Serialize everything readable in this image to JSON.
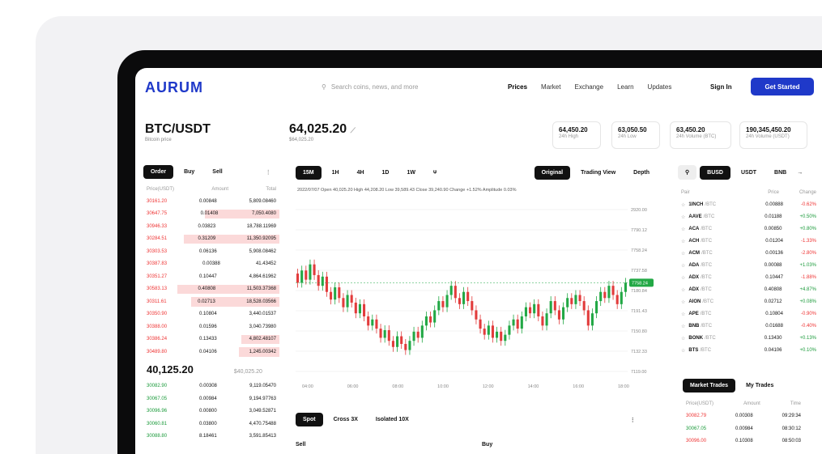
{
  "header": {
    "logo": "AURUM",
    "search_placeholder": "Search coins, news, and more",
    "nav": [
      "Prices",
      "Market",
      "Exchange",
      "Learn",
      "Updates"
    ],
    "signin": "Sign In",
    "get_started": "Get Started"
  },
  "pair": {
    "name": "BTC/USDT",
    "sub": "Bitcoin price"
  },
  "price": {
    "value": "64,025.20",
    "sub": "$64,025.20"
  },
  "stats": [
    {
      "value": "64,450.20",
      "label": "24h High"
    },
    {
      "value": "63,050.50",
      "label": "24h Low"
    },
    {
      "value": "63,450.20",
      "label": "24h Volume (BTC)"
    },
    {
      "value": "190,345,450.20",
      "label": "24h Volume (USDT)"
    }
  ],
  "orderbook": {
    "tabs": [
      "Order",
      "Buy",
      "Sell"
    ],
    "headers": [
      "Price(USDT)",
      "Amount",
      "Total"
    ],
    "asks": [
      [
        "30161.20",
        "0.00848",
        "5,809.08460",
        0.0
      ],
      [
        "30647.75",
        "0.01408",
        "7,050.4080",
        0.55
      ],
      [
        "30946.33",
        "0.03823",
        "18,788.11969",
        0.0
      ],
      [
        "30284.51",
        "0.31209",
        "11,350.92095",
        0.7
      ],
      [
        "30303.53",
        "0.06136",
        "5,908.08462",
        0.0
      ],
      [
        "30387.83",
        "0.00388",
        "41.43452",
        0.0
      ],
      [
        "30351.27",
        "0.10447",
        "4,864.61962",
        0.0
      ],
      [
        "30583.13",
        "0.40808",
        "11,503.37368",
        0.75
      ],
      [
        "30311.61",
        "0.02713",
        "18,528.03566",
        0.65
      ],
      [
        "30350.90",
        "0.10804",
        "3,440.01537",
        0.0
      ],
      [
        "30388.00",
        "0.01596",
        "3,040.73980",
        0.0
      ],
      [
        "30386.24",
        "0.13433",
        "4,802.48107",
        0.28
      ],
      [
        "30489.80",
        "0.04106",
        "1,245.00342",
        0.3
      ]
    ],
    "mid_price": "40,125.20",
    "mid_sub": "$40,025.20",
    "bids": [
      [
        "30082.90",
        "0.00308",
        "9,119.05470",
        0.0
      ],
      [
        "30067.05",
        "0.00984",
        "9,194.97763",
        0.0
      ],
      [
        "30096.96",
        "0.00800",
        "3,049.52871",
        0.0
      ],
      [
        "30060.81",
        "0.03800",
        "4,470.75488",
        0.0
      ],
      [
        "30088.80",
        "8.18461",
        "3,591.85413",
        0.0
      ]
    ]
  },
  "chart": {
    "intervals": [
      "15M",
      "1H",
      "4H",
      "1D",
      "1W"
    ],
    "views": [
      "Original",
      "Trading View",
      "Depth"
    ],
    "ohlc": "2022/07/07  Open 40,025.20  High 44,208.20  Low 39,589.43  Close 39,240.90  Change +1.52%  Amplitude 0.03%",
    "price_ticks": [
      "2920.00",
      "7790.12",
      "7758.24",
      "7737.58",
      "7180.84",
      "7191.43",
      "7150.80",
      "7132.33",
      "7119.00"
    ],
    "current_tag": "7758.24",
    "time_ticks": [
      "04:00",
      "06:00",
      "08:00",
      "10:00",
      "12:00",
      "14:00",
      "16:00",
      "18:00"
    ]
  },
  "chart_data": {
    "type": "candlestick",
    "candles": [
      [
        0.64,
        0.58
      ],
      [
        0.58,
        0.66
      ],
      [
        0.66,
        0.6
      ],
      [
        0.6,
        0.7
      ],
      [
        0.7,
        0.63
      ],
      [
        0.63,
        0.56
      ],
      [
        0.56,
        0.62
      ],
      [
        0.62,
        0.52
      ],
      [
        0.52,
        0.47
      ],
      [
        0.47,
        0.55
      ],
      [
        0.55,
        0.48
      ],
      [
        0.48,
        0.42
      ],
      [
        0.42,
        0.5
      ],
      [
        0.5,
        0.45
      ],
      [
        0.45,
        0.38
      ],
      [
        0.38,
        0.44
      ],
      [
        0.44,
        0.36
      ],
      [
        0.36,
        0.3
      ],
      [
        0.3,
        0.34
      ],
      [
        0.34,
        0.28
      ],
      [
        0.28,
        0.22
      ],
      [
        0.22,
        0.27
      ],
      [
        0.27,
        0.2
      ],
      [
        0.2,
        0.16
      ],
      [
        0.16,
        0.23
      ],
      [
        0.23,
        0.18
      ],
      [
        0.18,
        0.14
      ],
      [
        0.14,
        0.2
      ],
      [
        0.2,
        0.26
      ],
      [
        0.26,
        0.22
      ],
      [
        0.22,
        0.3
      ],
      [
        0.3,
        0.36
      ],
      [
        0.36,
        0.32
      ],
      [
        0.32,
        0.4
      ],
      [
        0.4,
        0.46
      ],
      [
        0.46,
        0.42
      ],
      [
        0.42,
        0.5
      ],
      [
        0.5,
        0.56
      ],
      [
        0.56,
        0.48
      ],
      [
        0.48,
        0.44
      ],
      [
        0.44,
        0.52
      ],
      [
        0.52,
        0.46
      ],
      [
        0.46,
        0.4
      ],
      [
        0.4,
        0.34
      ],
      [
        0.34,
        0.28
      ],
      [
        0.28,
        0.24
      ],
      [
        0.24,
        0.3
      ],
      [
        0.3,
        0.22
      ],
      [
        0.22,
        0.26
      ],
      [
        0.26,
        0.2
      ],
      [
        0.2,
        0.24
      ],
      [
        0.24,
        0.3
      ],
      [
        0.3,
        0.34
      ],
      [
        0.34,
        0.28
      ],
      [
        0.28,
        0.36
      ],
      [
        0.36,
        0.42
      ],
      [
        0.42,
        0.38
      ],
      [
        0.38,
        0.44
      ],
      [
        0.44,
        0.36
      ],
      [
        0.36,
        0.3
      ],
      [
        0.3,
        0.38
      ],
      [
        0.38,
        0.46
      ],
      [
        0.46,
        0.4
      ],
      [
        0.4,
        0.34
      ],
      [
        0.34,
        0.42
      ],
      [
        0.42,
        0.48
      ],
      [
        0.48,
        0.44
      ],
      [
        0.44,
        0.5
      ],
      [
        0.5,
        0.46
      ],
      [
        0.46,
        0.4
      ],
      [
        0.4,
        0.3
      ],
      [
        0.3,
        0.38
      ],
      [
        0.38,
        0.46
      ],
      [
        0.46,
        0.52
      ],
      [
        0.52,
        0.48
      ],
      [
        0.48,
        0.56
      ],
      [
        0.56,
        0.5
      ],
      [
        0.5,
        0.44
      ],
      [
        0.44,
        0.52
      ],
      [
        0.52,
        0.58
      ]
    ]
  },
  "orders": {
    "tabs": [
      "Spot",
      "Cross 3X",
      "Isolated 10X"
    ],
    "sell": "Sell",
    "buy": "Buy"
  },
  "markets": {
    "tabs": [
      "BUSD",
      "USDT",
      "BNB"
    ],
    "headers": [
      "Pair",
      "Price",
      "Change"
    ],
    "rows": [
      [
        "1INCH",
        "/BTC",
        "0.00888",
        "-0.62%",
        "red"
      ],
      [
        "AAVE",
        "/BTC",
        "0.01188",
        "+0.50%",
        "grn"
      ],
      [
        "ACA",
        "/BTC",
        "0.00850",
        "+0.80%",
        "grn"
      ],
      [
        "ACH",
        "/BTC",
        "0.01204",
        "-1.33%",
        "red"
      ],
      [
        "ACM",
        "/BTC",
        "0.00136",
        "-2.80%",
        "red"
      ],
      [
        "ADA",
        "/BTC",
        "0.00088",
        "+1.03%",
        "grn"
      ],
      [
        "ADX",
        "/BTC",
        "0.10447",
        "-1.88%",
        "red"
      ],
      [
        "ADX",
        "/BTC",
        "0.40808",
        "+4.87%",
        "grn"
      ],
      [
        "AION",
        "/BTC",
        "0.02712",
        "+0.08%",
        "grn"
      ],
      [
        "APE",
        "/BTC",
        "0.10804",
        "-0.90%",
        "red"
      ],
      [
        "BNB",
        "/BTC",
        "0.01688",
        "-0.40%",
        "red"
      ],
      [
        "BONK",
        "/BTC",
        "0.13430",
        "+0.13%",
        "grn"
      ],
      [
        "BTS",
        "/BTC",
        "0.04106",
        "+0.10%",
        "grn"
      ]
    ]
  },
  "trades": {
    "tabs": [
      "Market Trades",
      "My Trades"
    ],
    "headers": [
      "Price(USDT)",
      "Amount",
      "Time"
    ],
    "rows": [
      [
        "30082.79",
        "0.00308",
        "09:29:34",
        "red"
      ],
      [
        "30067.05",
        "0.00984",
        "08:30:12",
        "grn"
      ],
      [
        "30096.00",
        "0.10308",
        "08:50:03",
        "red"
      ]
    ]
  }
}
